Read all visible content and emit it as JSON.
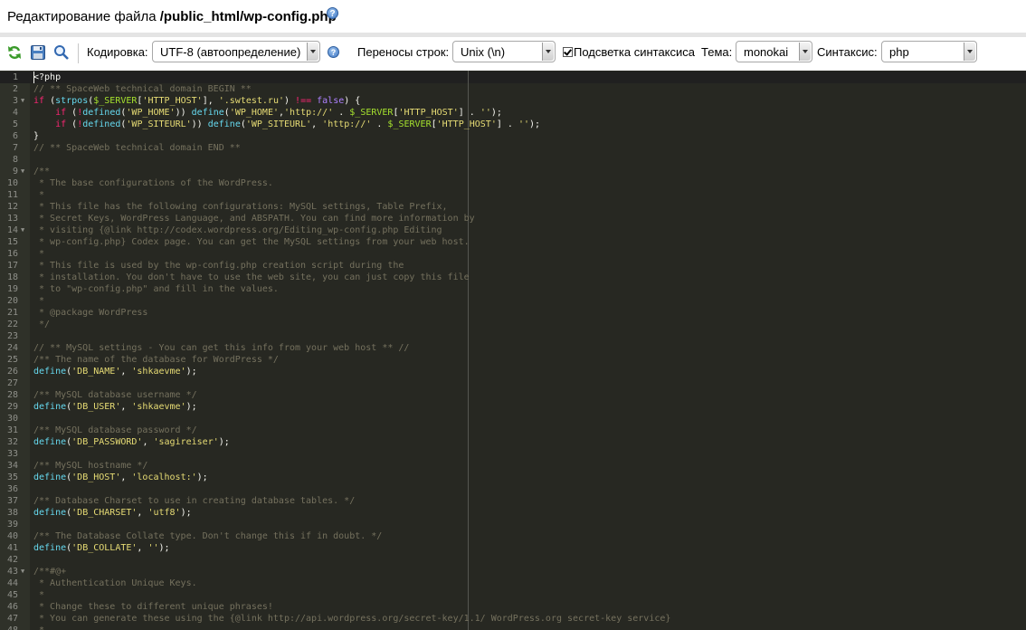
{
  "title": {
    "prefix": "Редактирование файла ",
    "filename": "/public_html/wp-config.php",
    "help": "?"
  },
  "toolbar": {
    "encoding_label": "Кодировка:",
    "encoding_value": "UTF-8 (автоопределение)",
    "line_endings_label": "Переносы строк:",
    "line_endings_value": "Unix (\\n)",
    "highlight_label": "Подсветка синтаксиса",
    "theme_label": "Тема:",
    "theme_value": "monokai",
    "syntax_label": "Синтаксис:",
    "syntax_value": "php",
    "help": "?"
  },
  "editor": {
    "colors": {
      "background": "#272822",
      "comment": "#75715e",
      "keyword": "#f92672",
      "string": "#e6db74",
      "function": "#66d9ef",
      "variable": "#a6e22e",
      "constant": "#ae81ff",
      "plain": "#f8f8f2"
    },
    "folds": [
      3,
      9,
      14,
      43
    ],
    "lines": [
      [
        [
          "p",
          "<?php"
        ]
      ],
      [
        [
          "c",
          "// ** SpaceWeb technical domain BEGIN **"
        ]
      ],
      [
        [
          "k",
          "if"
        ],
        [
          "p",
          " ("
        ],
        [
          "f",
          "strpos"
        ],
        [
          "p",
          "("
        ],
        [
          "v",
          "$_SERVER"
        ],
        [
          "p",
          "["
        ],
        [
          "s",
          "'HTTP_HOST'"
        ],
        [
          "p",
          "], "
        ],
        [
          "s",
          "'.swtest.ru'"
        ],
        [
          "p",
          ") "
        ],
        [
          "k",
          "!=="
        ],
        [
          "p",
          " "
        ],
        [
          "n",
          "false"
        ],
        [
          "p",
          ") {"
        ]
      ],
      [
        [
          "p",
          "    "
        ],
        [
          "k",
          "if"
        ],
        [
          "p",
          " ("
        ],
        [
          "k",
          "!"
        ],
        [
          "f",
          "defined"
        ],
        [
          "p",
          "("
        ],
        [
          "s",
          "'WP_HOME'"
        ],
        [
          "p",
          ")) "
        ],
        [
          "f",
          "define"
        ],
        [
          "p",
          "("
        ],
        [
          "s",
          "'WP_HOME'"
        ],
        [
          "p",
          ","
        ],
        [
          "s",
          "'http://'"
        ],
        [
          "p",
          " . "
        ],
        [
          "v",
          "$_SERVER"
        ],
        [
          "p",
          "["
        ],
        [
          "s",
          "'HTTP_HOST'"
        ],
        [
          "p",
          "] . "
        ],
        [
          "s",
          "''"
        ],
        [
          "p",
          ");"
        ]
      ],
      [
        [
          "p",
          "    "
        ],
        [
          "k",
          "if"
        ],
        [
          "p",
          " ("
        ],
        [
          "k",
          "!"
        ],
        [
          "f",
          "defined"
        ],
        [
          "p",
          "("
        ],
        [
          "s",
          "'WP_SITEURL'"
        ],
        [
          "p",
          ")) "
        ],
        [
          "f",
          "define"
        ],
        [
          "p",
          "("
        ],
        [
          "s",
          "'WP_SITEURL'"
        ],
        [
          "p",
          ", "
        ],
        [
          "s",
          "'http://'"
        ],
        [
          "p",
          " . "
        ],
        [
          "v",
          "$_SERVER"
        ],
        [
          "p",
          "["
        ],
        [
          "s",
          "'HTTP_HOST'"
        ],
        [
          "p",
          "] . "
        ],
        [
          "s",
          "''"
        ],
        [
          "p",
          ");"
        ]
      ],
      [
        [
          "p",
          "}"
        ]
      ],
      [
        [
          "c",
          "// ** SpaceWeb technical domain END **"
        ]
      ],
      [],
      [
        [
          "c",
          "/**"
        ]
      ],
      [
        [
          "c",
          " * The base configurations of the WordPress."
        ]
      ],
      [
        [
          "c",
          " *"
        ]
      ],
      [
        [
          "c",
          " * This file has the following configurations: MySQL settings, Table Prefix,"
        ]
      ],
      [
        [
          "c",
          " * Secret Keys, WordPress Language, and ABSPATH. You can find more information by"
        ]
      ],
      [
        [
          "c",
          " * visiting {@link http://codex.wordpress.org/Editing_wp-config.php Editing"
        ]
      ],
      [
        [
          "c",
          " * wp-config.php} Codex page. You can get the MySQL settings from your web host."
        ]
      ],
      [
        [
          "c",
          " *"
        ]
      ],
      [
        [
          "c",
          " * This file is used by the wp-config.php creation script during the"
        ]
      ],
      [
        [
          "c",
          " * installation. You don't have to use the web site, you can just copy this file"
        ]
      ],
      [
        [
          "c",
          " * to \"wp-config.php\" and fill in the values."
        ]
      ],
      [
        [
          "c",
          " *"
        ]
      ],
      [
        [
          "c",
          " * @package WordPress"
        ]
      ],
      [
        [
          "c",
          " */"
        ]
      ],
      [],
      [
        [
          "c",
          "// ** MySQL settings - You can get this info from your web host ** //"
        ]
      ],
      [
        [
          "c",
          "/** The name of the database for WordPress */"
        ]
      ],
      [
        [
          "f",
          "define"
        ],
        [
          "p",
          "("
        ],
        [
          "s",
          "'DB_NAME'"
        ],
        [
          "p",
          ", "
        ],
        [
          "s",
          "'shkaevme'"
        ],
        [
          "p",
          ");"
        ]
      ],
      [],
      [
        [
          "c",
          "/** MySQL database username */"
        ]
      ],
      [
        [
          "f",
          "define"
        ],
        [
          "p",
          "("
        ],
        [
          "s",
          "'DB_USER'"
        ],
        [
          "p",
          ", "
        ],
        [
          "s",
          "'shkaevme'"
        ],
        [
          "p",
          ");"
        ]
      ],
      [],
      [
        [
          "c",
          "/** MySQL database password */"
        ]
      ],
      [
        [
          "f",
          "define"
        ],
        [
          "p",
          "("
        ],
        [
          "s",
          "'DB_PASSWORD'"
        ],
        [
          "p",
          ", "
        ],
        [
          "s",
          "'sagireiser'"
        ],
        [
          "p",
          ");"
        ]
      ],
      [],
      [
        [
          "c",
          "/** MySQL hostname */"
        ]
      ],
      [
        [
          "f",
          "define"
        ],
        [
          "p",
          "("
        ],
        [
          "s",
          "'DB_HOST'"
        ],
        [
          "p",
          ", "
        ],
        [
          "s",
          "'localhost:'"
        ],
        [
          "p",
          ");"
        ]
      ],
      [],
      [
        [
          "c",
          "/** Database Charset to use in creating database tables. */"
        ]
      ],
      [
        [
          "f",
          "define"
        ],
        [
          "p",
          "("
        ],
        [
          "s",
          "'DB_CHARSET'"
        ],
        [
          "p",
          ", "
        ],
        [
          "s",
          "'utf8'"
        ],
        [
          "p",
          ");"
        ]
      ],
      [],
      [
        [
          "c",
          "/** The Database Collate type. Don't change this if in doubt. */"
        ]
      ],
      [
        [
          "f",
          "define"
        ],
        [
          "p",
          "("
        ],
        [
          "s",
          "'DB_COLLATE'"
        ],
        [
          "p",
          ", "
        ],
        [
          "s",
          "''"
        ],
        [
          "p",
          ");"
        ]
      ],
      [],
      [
        [
          "c",
          "/**#@+"
        ]
      ],
      [
        [
          "c",
          " * Authentication Unique Keys."
        ]
      ],
      [
        [
          "c",
          " *"
        ]
      ],
      [
        [
          "c",
          " * Change these to different unique phrases!"
        ]
      ],
      [
        [
          "c",
          " * You can generate these using the {@link http://api.wordpress.org/secret-key/1.1/ WordPress.org secret-key service}"
        ]
      ],
      [
        [
          "c",
          " *"
        ]
      ]
    ]
  }
}
